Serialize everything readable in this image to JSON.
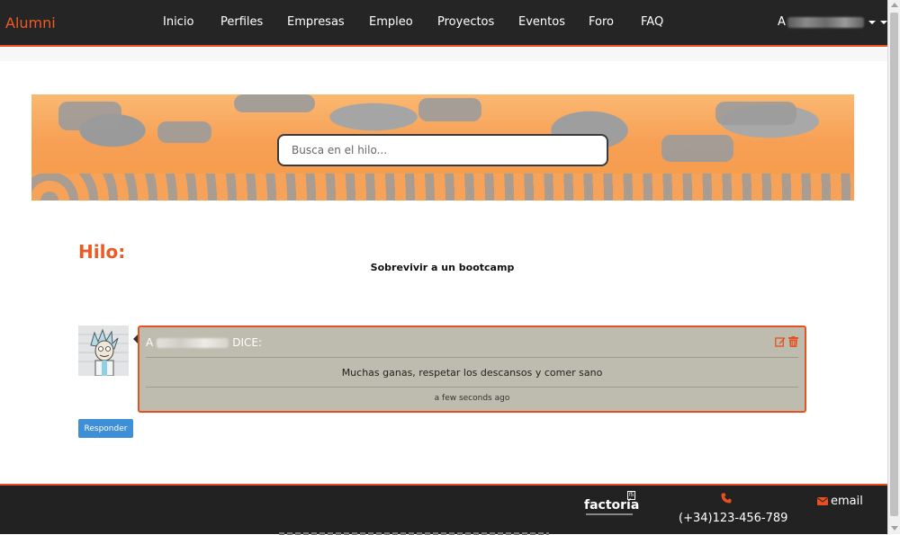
{
  "navbar": {
    "brand": "Alumni",
    "items": [
      {
        "label": "Inicio"
      },
      {
        "label": "Perfiles"
      },
      {
        "label": "Empresas"
      },
      {
        "label": "Empleo"
      },
      {
        "label": "Proyectos"
      },
      {
        "label": "Eventos"
      },
      {
        "label": "Foro"
      },
      {
        "label": "FAQ"
      }
    ],
    "user_initial": "A"
  },
  "banner": {
    "search_placeholder": "Busca en el hilo..."
  },
  "thread": {
    "heading": "Hilo:",
    "subject": "Sobrevivir a un bootcamp"
  },
  "post": {
    "author_initial": "A",
    "says": "DICE:",
    "body": "Muchas ganas, respetar los descansos y comer sano",
    "time": "a few seconds ago"
  },
  "reply_label": "Responder",
  "footer": {
    "logo_text": "factoría",
    "logo_mark": "f5",
    "phone": "(+34)123-456-789",
    "email_label": "email"
  },
  "colors": {
    "accent": "#e8501f",
    "navbar_bg": "#252525",
    "post_bg": "#bdbcae",
    "reply_button": "#3f8fd6"
  }
}
